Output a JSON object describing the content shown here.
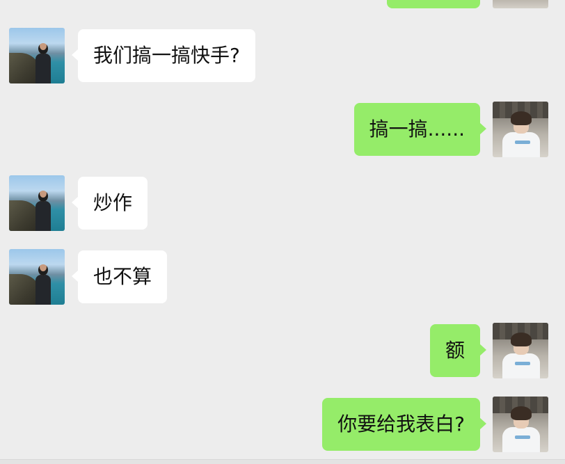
{
  "messages": [
    {
      "sender": "friend",
      "text": "我们搞一搞快手?"
    },
    {
      "sender": "me",
      "text": "搞一搞......"
    },
    {
      "sender": "friend",
      "text": "炒作"
    },
    {
      "sender": "friend",
      "text": "也不算"
    },
    {
      "sender": "me",
      "text": "额"
    },
    {
      "sender": "me",
      "text": "你要给我表白?"
    }
  ],
  "colors": {
    "background": "#ededed",
    "incoming_bubble": "#ffffff",
    "outgoing_bubble": "#95ec69",
    "text": "#111111"
  },
  "icons": {
    "friend_avatar": "avatar-photo-seaside",
    "my_avatar": "avatar-photo-portrait"
  }
}
